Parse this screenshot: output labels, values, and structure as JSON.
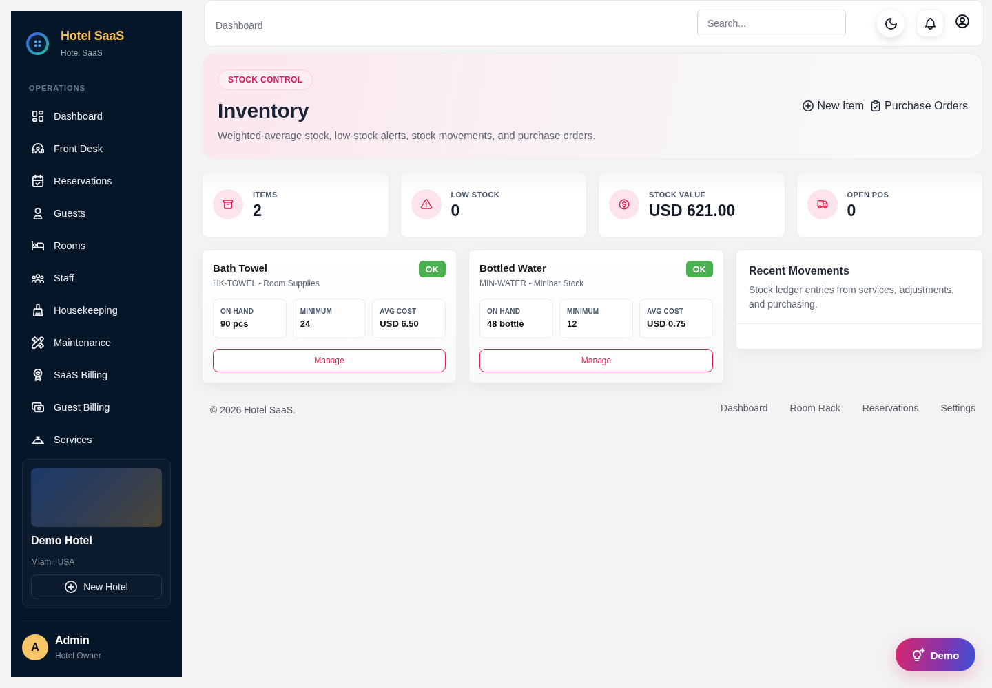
{
  "sidebar": {
    "brand": {
      "title": "Hotel SaaS",
      "subtitle": "Hotel SaaS"
    },
    "section_label": "OPERATIONS",
    "items": [
      {
        "label": "Dashboard",
        "selected": false
      },
      {
        "label": "Front Desk",
        "selected": false
      },
      {
        "label": "Reservations",
        "selected": false
      },
      {
        "label": "Guests",
        "selected": false
      },
      {
        "label": "Rooms",
        "selected": false
      },
      {
        "label": "Staff",
        "selected": false
      },
      {
        "label": "Housekeeping",
        "selected": false
      },
      {
        "label": "Maintenance",
        "selected": false
      },
      {
        "label": "SaaS Billing",
        "selected": false
      },
      {
        "label": "Guest Billing",
        "selected": false
      },
      {
        "label": "Services",
        "selected": false
      }
    ],
    "hotel_card": {
      "name": "Demo Hotel",
      "location": "Miami, USA",
      "button": "New Hotel"
    },
    "user": {
      "initial": "A",
      "name": "Admin",
      "role": "Hotel Owner"
    }
  },
  "topbar": {
    "breadcrumb": "Dashboard",
    "search": {
      "placeholder": "Search..."
    }
  },
  "hero": {
    "badge": "STOCK CONTROL",
    "title": "Inventory",
    "description": "Weighted-average stock, low-stock alerts, stock movements, and purchase orders.",
    "actions": [
      "New Item",
      "Purchase Orders"
    ]
  },
  "stats": [
    {
      "label": "ITEMS",
      "value": "2"
    },
    {
      "label": "LOW STOCK",
      "value": "0"
    },
    {
      "label": "STOCK VALUE",
      "value": "USD 621.00"
    },
    {
      "label": "OPEN POS",
      "value": "0"
    }
  ],
  "items": [
    {
      "name": "Bath Towel",
      "meta": "HK-TOWEL - Room Supplies",
      "status": "OK",
      "metrics": [
        {
          "label": "ON HAND",
          "value": "90 pcs"
        },
        {
          "label": "MINIMUM",
          "value": "24"
        },
        {
          "label": "AVG COST",
          "value": "USD 6.50"
        }
      ],
      "button": "Manage"
    },
    {
      "name": "Bottled Water",
      "meta": "MIN-WATER - Minibar Stock",
      "status": "OK",
      "metrics": [
        {
          "label": "ON HAND",
          "value": "48 bottle"
        },
        {
          "label": "MINIMUM",
          "value": "12"
        },
        {
          "label": "AVG COST",
          "value": "USD 0.75"
        }
      ],
      "button": "Manage"
    }
  ],
  "recent_movements": {
    "title": "Recent Movements",
    "description": "Stock ledger entries from services, adjustments, and purchasing."
  },
  "footer": {
    "copyright": "© 2026 Hotel SaaS.",
    "links": [
      "Dashboard",
      "Room Rack",
      "Reservations",
      "Settings"
    ]
  },
  "demo_button": {
    "label": "Demo"
  }
}
